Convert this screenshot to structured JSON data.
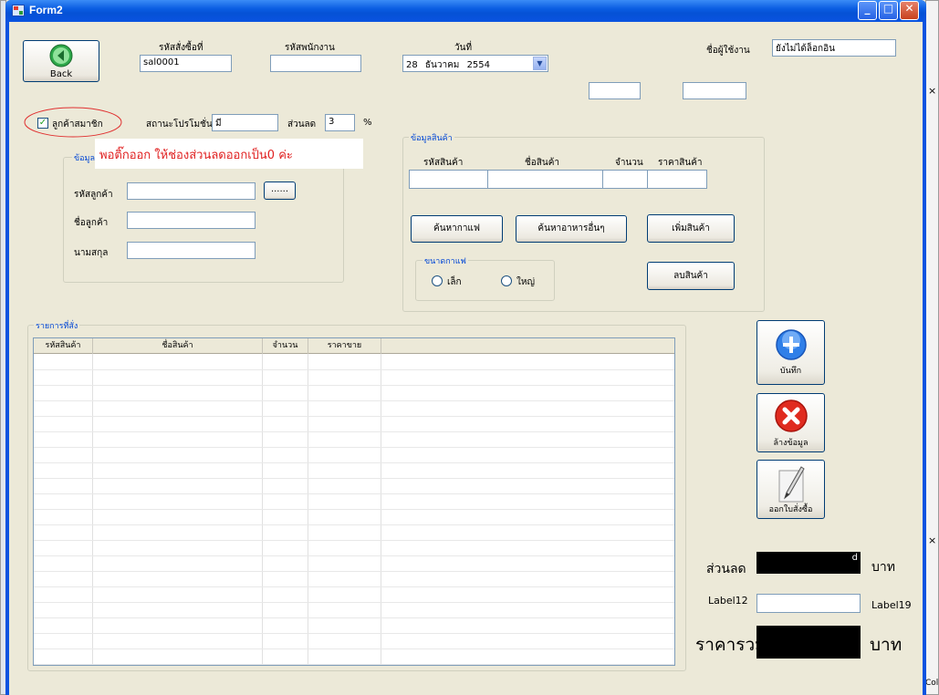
{
  "window": {
    "title": "Form2"
  },
  "header": {
    "back_label": "Back",
    "order_id_label": "รหัสสั่งซื้อที่",
    "order_id_value": "sal0001",
    "employee_id_label": "รหัสพนักงาน",
    "employee_id_value": "",
    "date_label": "วันที่",
    "date_day": "28",
    "date_month": "ธันวาคม",
    "date_year": "2554",
    "username_label": "ชื่อผู้ใช้งาน",
    "username_value": "ยังไม่ได้ล็อกอิน"
  },
  "member": {
    "checkbox_label": "ลูกค้าสมาชิก",
    "checked": true,
    "promo_status_label": "สถานะโปรโมชั่น",
    "promo_status_value": "มี",
    "discount_label": "ส่วนลด",
    "discount_value": "3",
    "percent_sign": "%",
    "annotation": "พอติ๊กออก  ให้ช่องส่วนลดออกเป็น0 ค่ะ"
  },
  "customer": {
    "group_title": "ข้อมูล",
    "id_label": "รหัสลูกค้า",
    "browse_label": "......",
    "name_label": "ชื่อลูกค้า",
    "surname_label": "นามสกุล"
  },
  "product": {
    "group_title": "ข้อมูลสินค้า",
    "col_id": "รหัสสินค้า",
    "col_name": "ชื่อสินค้า",
    "col_qty": "จำนวน",
    "col_price": "ราคาสินค้า",
    "search_coffee": "ค้นหากาแฟ",
    "search_food": "ค้นหาอาหารอื่นๆ",
    "add_product": "เพิ่มสินค้า",
    "remove_product": "ลบสินค้า",
    "size_group_title": "ขนาดกาแฟ",
    "size_small": "เล็ก",
    "size_large": "ใหญ่"
  },
  "orders": {
    "group_title": "รายการที่สั่ง",
    "columns": [
      "รหัสสินค้า",
      "ชื่อสินค้า",
      "จำนวน",
      "ราคาขาย"
    ]
  },
  "actions": {
    "save": "บันทึก",
    "clear": "ล้างข้อมูล",
    "receipt": "ออกใบสั่งซื้อ"
  },
  "totals": {
    "discount_label": "ส่วนลด",
    "discount_value": "d",
    "baht_1": "บาท",
    "label12": "Label12",
    "label19": "Label19",
    "total_label": "ราคารวม",
    "baht_2": "บาท"
  },
  "background": {
    "right_x1": "×",
    "right_x2": "×",
    "right_col": "Col"
  }
}
